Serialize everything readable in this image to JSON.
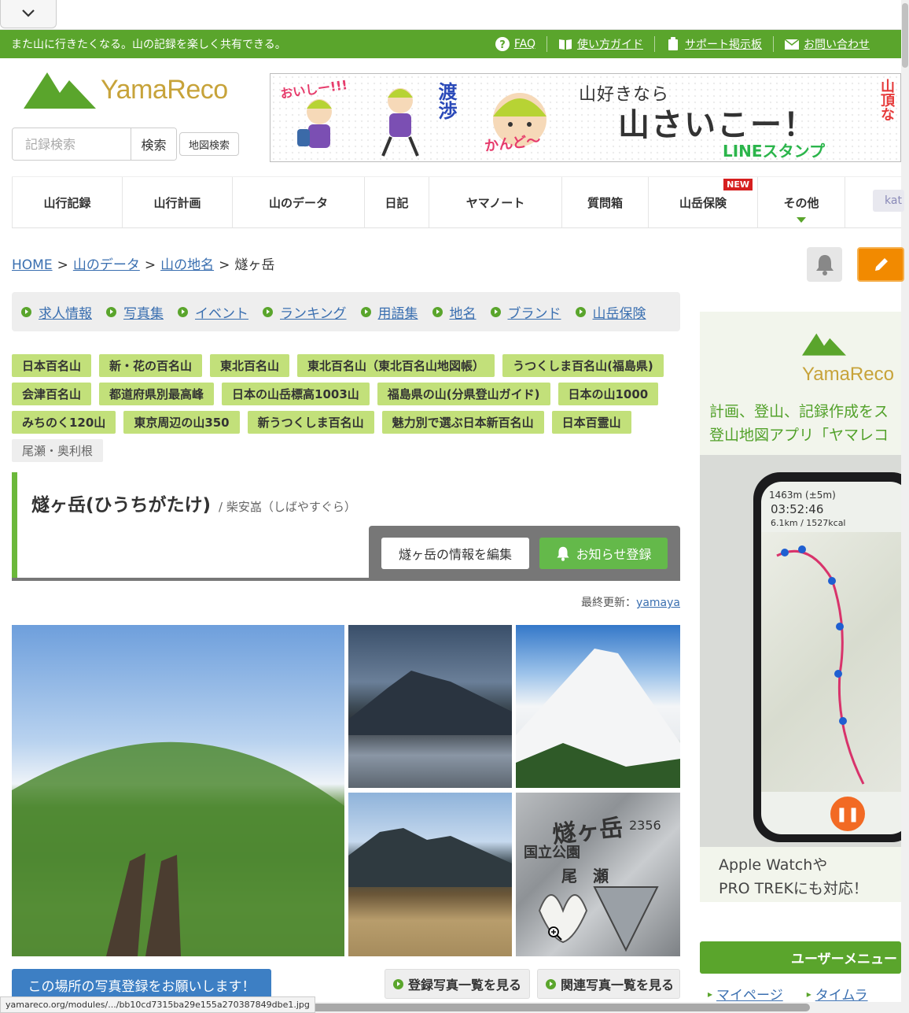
{
  "topbar": {
    "tagline": "また山に行きたくなる。山の記録を楽しく共有できる。",
    "links": [
      {
        "label": "FAQ",
        "icon": "question-icon"
      },
      {
        "label": "使い方ガイド",
        "icon": "book-icon"
      },
      {
        "label": "サポート掲示板",
        "icon": "clipboard-icon"
      },
      {
        "label": "お問い合わせ",
        "icon": "mail-icon"
      }
    ]
  },
  "header": {
    "logo_text": "YamaReco",
    "search_placeholder": "記録検索",
    "search_button": "検索",
    "map_search_button": "地図検索"
  },
  "banner": {
    "line1": "山好きなら",
    "line2": "山さいこー！",
    "line3": "LINEスタンプ",
    "oishi": "おいしー!!!",
    "watari": "渡渉",
    "kando": "かんど〜",
    "sancho": "山頂な"
  },
  "nav": {
    "items": [
      {
        "label": "山行記録"
      },
      {
        "label": "山行計画"
      },
      {
        "label": "山のデータ"
      },
      {
        "label": "日記"
      },
      {
        "label": "ヤマノート"
      },
      {
        "label": "質問箱"
      },
      {
        "label": "山岳保険",
        "badge": "NEW"
      },
      {
        "label": "その他"
      }
    ],
    "user_chip": "kat"
  },
  "breadcrumb": {
    "home": "HOME",
    "l1": "山のデータ",
    "l2": "山の地名",
    "current": "燧ヶ岳",
    "sep": ">"
  },
  "sublinks": [
    "求人情報",
    "写真集",
    "イベント",
    "ランキング",
    "用語集",
    "地名",
    "ブランド",
    "山岳保険"
  ],
  "tags": [
    "日本百名山",
    "新・花の百名山",
    "東北百名山",
    "東北百名山（東北百名山地図帳）",
    "うつくしま百名山(福島県)",
    "会津百名山",
    "都道府県別最高峰",
    "日本の山岳標高1003山",
    "福島県の山(分県登山ガイド)",
    "日本の山1000",
    "みちのく120山",
    "東京周辺の山350",
    "新うつくしま百名山",
    "魅力別で選ぶ日本新百名山",
    "日本百霊山"
  ],
  "area_tag": "尾瀬・奥利根",
  "mountain": {
    "title": "燧ヶ岳(ひうちがたけ)",
    "alias": "/ 柴安嵓（しばやすぐら）",
    "edit_button": "燧ヶ岳の情報を編集",
    "notify_button": "お知らせ登録",
    "last_updated_label": "最終更新：",
    "last_updated_user": "yamaya"
  },
  "photo_sign": {
    "kanji": "燧ヶ岳",
    "elevation": "2356",
    "line2": "国立公園",
    "line3": "尾　瀬"
  },
  "photo_actions": {
    "request": "この場所の写真登録をお願いします！",
    "list_registered": "登録写真一覧を見る",
    "list_related": "関連写真一覧を見る"
  },
  "sidebar_ad": {
    "logo_text": "YamaReco",
    "copy1": "計画、登山、記録作成をス",
    "copy2": "登山地図アプリ「ヤマレコ",
    "stats": "1463m (±5m)",
    "timer": "03:52:46",
    "dist": "6.1km / 1527kcal",
    "footer1": "Apple Watchや",
    "footer2": "PRO TREKにも対応！"
  },
  "sidebar": {
    "user_menu": "ユーザーメニュー",
    "links": [
      "マイページ",
      "タイムラ"
    ]
  },
  "status_url": "yamareco.org/modules/.../bb10cd7315ba29e155a270387849dbe1.jpg",
  "colors": {
    "brand_green": "#5aa52c",
    "tag_green": "#c2e07a",
    "link_blue": "#3a6fb0",
    "orange": "#f28a00"
  }
}
